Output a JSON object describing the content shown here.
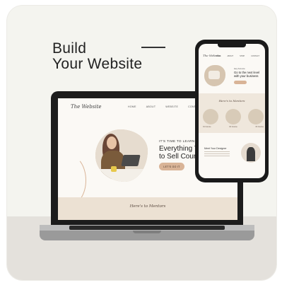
{
  "hero": {
    "line1": "Build",
    "line2": "Your Website"
  },
  "laptop_site": {
    "logo": "The Website",
    "nav": [
      "HOME",
      "ABOUT",
      "WEBSITE",
      "CONTACT"
    ],
    "eyebrow": "IT'S TIME TO LEARN",
    "headline_line1": "Everything You",
    "headline_line2": "to Sell Courses",
    "cta": "LET'S GO IT",
    "script": "Here's to Mentors"
  },
  "phone_site": {
    "logo": "The Website",
    "nav": [
      "HOME",
      "ABOUT",
      "SHOP",
      "CONTACT"
    ],
    "small": "Hey how are",
    "title_line1": "Go to the next level",
    "title_line2": "with your business",
    "script": "Here's to Mentors",
    "thumb_captions": [
      "01 Course",
      "02 Course",
      "03 Course"
    ],
    "meet": "Meet Your Designer"
  },
  "colors": {
    "card_bg": "#f4f4ef",
    "accent": "#d9b497",
    "band": "#ece1d3",
    "device": "#1c1c1c"
  }
}
